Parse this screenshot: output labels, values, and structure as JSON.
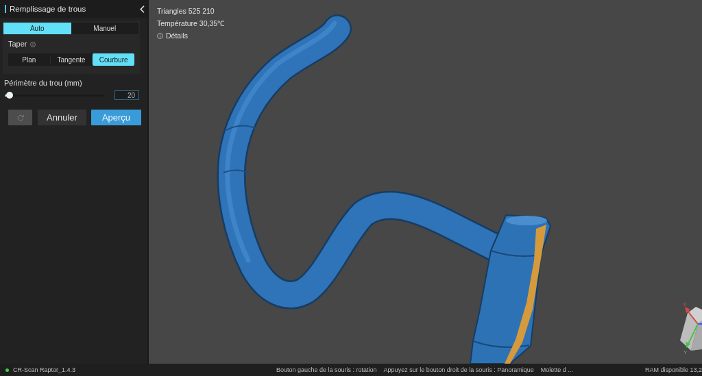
{
  "panel": {
    "title": "Remplissage de trous",
    "modes": [
      {
        "label": "Auto",
        "selected": true
      },
      {
        "label": "Manuel",
        "selected": false
      }
    ],
    "taper": {
      "label": "Taper",
      "options": [
        {
          "label": "Plan",
          "selected": false
        },
        {
          "label": "Tangente",
          "selected": false
        },
        {
          "label": "Courbure",
          "selected": true
        }
      ]
    },
    "perimeter": {
      "label": "Périmètre du trou (mm)",
      "level": 0.05,
      "value": "20"
    },
    "buttons": [
      {
        "kind": "reset",
        "disabled": true
      },
      {
        "kind": "secondary",
        "label": "Annuler"
      },
      {
        "kind": "primary",
        "label": "Aperçu"
      }
    ]
  },
  "viewport": {
    "info": [
      {
        "kind": "text",
        "text": "Triangles 525 210"
      },
      {
        "kind": "text",
        "text": "Température 30,35℃"
      },
      {
        "kind": "link",
        "text": "Détails"
      }
    ],
    "gizmo": {
      "x_label": "X",
      "y_label": "Y"
    }
  },
  "status_bar": {
    "app": {
      "label": "CR-Scan Raptor_1.4.3",
      "online": true
    },
    "hints": [
      "Bouton gauche de la souris : rotation",
      "Appuyez sur le bouton droit de la souris : Panoramique",
      "Molette d ..."
    ],
    "ram": "RAM disponible 13,2"
  }
}
